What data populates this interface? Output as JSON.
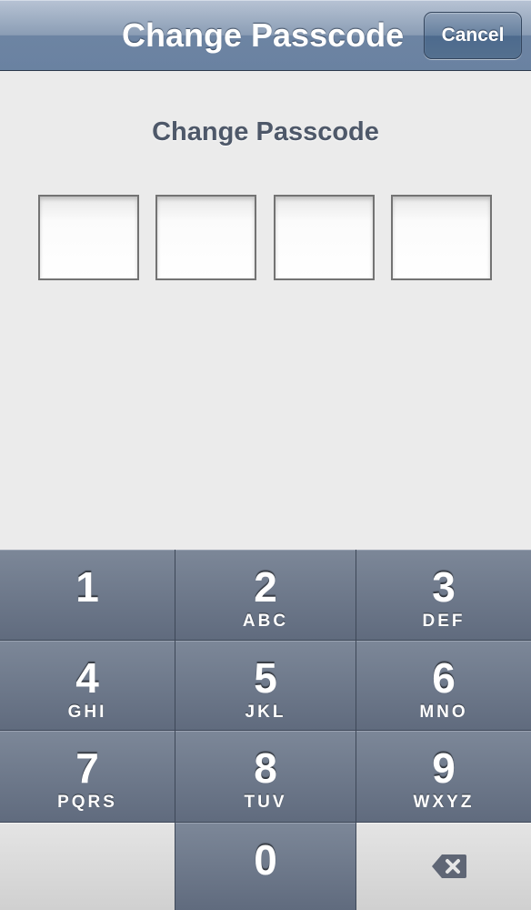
{
  "navbar": {
    "title": "Change Passcode",
    "cancel_label": "Cancel"
  },
  "main": {
    "prompt": "Change Passcode",
    "passcode_digits_entered": 0,
    "passcode_length": 4
  },
  "keypad": {
    "keys": [
      {
        "digit": "1",
        "letters": ""
      },
      {
        "digit": "2",
        "letters": "ABC"
      },
      {
        "digit": "3",
        "letters": "DEF"
      },
      {
        "digit": "4",
        "letters": "GHI"
      },
      {
        "digit": "5",
        "letters": "JKL"
      },
      {
        "digit": "6",
        "letters": "MNO"
      },
      {
        "digit": "7",
        "letters": "PQRS"
      },
      {
        "digit": "8",
        "letters": "TUV"
      },
      {
        "digit": "9",
        "letters": "WXYZ"
      },
      {
        "digit": "0",
        "letters": ""
      }
    ],
    "delete_icon": "delete-backspace-icon"
  },
  "colors": {
    "navbar": "#6d84a3",
    "key": "#606b7e",
    "background": "#ebebeb",
    "prompt_text": "#4e5869"
  }
}
